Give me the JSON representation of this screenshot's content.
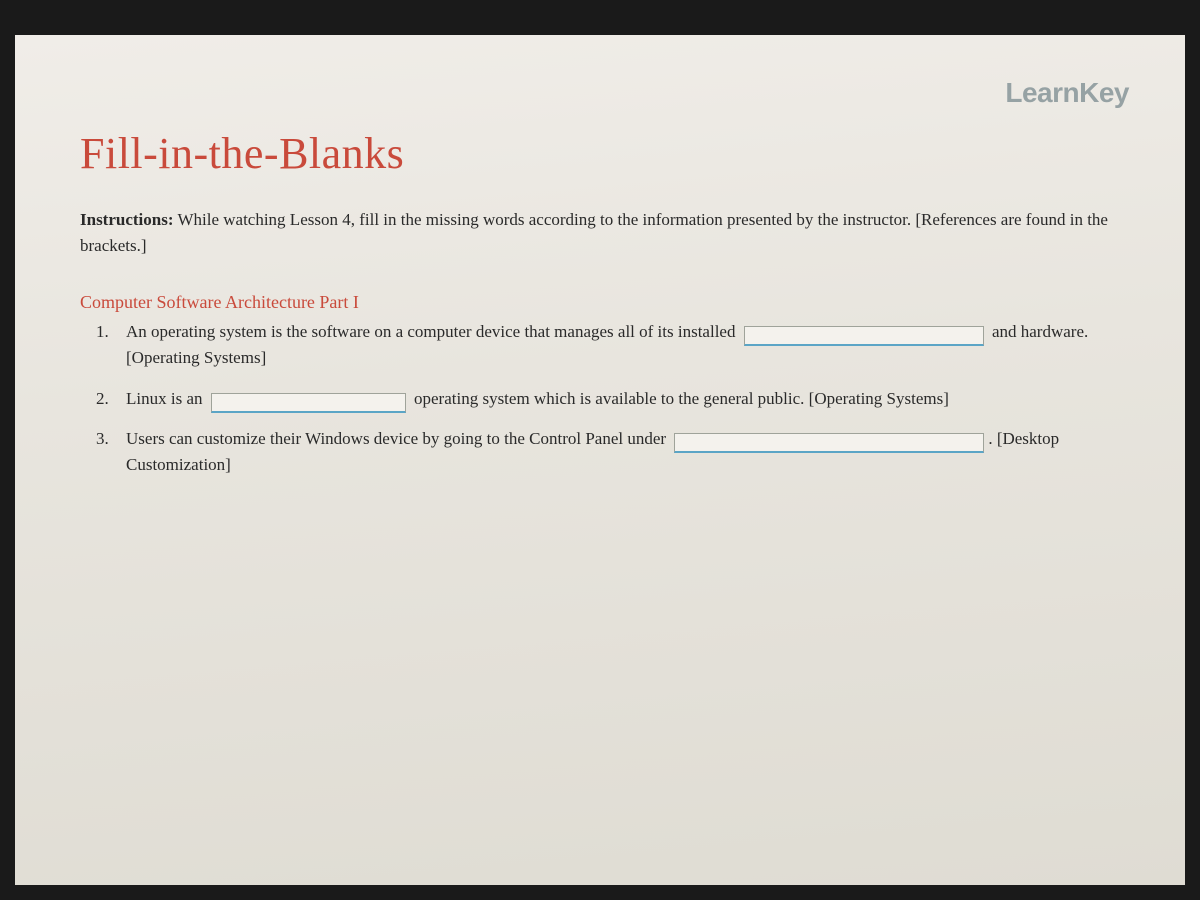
{
  "brand": "LearnKey",
  "title": "Fill-in-the-Blanks",
  "instructions_label": "Instructions:",
  "instructions_text": " While watching Lesson 4, fill in the missing words according to the information presented by the instructor. [References are found in the brackets.]",
  "section_heading": "Computer Software Architecture Part I",
  "questions": [
    {
      "num": "1.",
      "pre": "An operating system is the software on a computer device that manages all of its installed ",
      "post": " and hardware. [Operating Systems]",
      "blank_value": ""
    },
    {
      "num": "2.",
      "pre": "Linux is an ",
      "post": " operating system which is available to the general public. [Operating Systems]",
      "blank_value": ""
    },
    {
      "num": "3.",
      "pre": "Users can customize their Windows device by going to the Control Panel under ",
      "post": ". [Desktop Customization]",
      "blank_value": ""
    }
  ]
}
